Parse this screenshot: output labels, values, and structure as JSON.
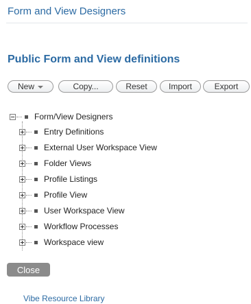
{
  "header": {
    "title": "Form and View Designers"
  },
  "section": {
    "heading": "Public Form and View definitions"
  },
  "toolbar": {
    "new_label": "New",
    "copy_label": "Copy...",
    "reset_label": "Reset",
    "import_label": "Import",
    "export_label": "Export"
  },
  "tree": {
    "root_label": "Form/View Designers",
    "items": [
      {
        "label": "Entry Definitions"
      },
      {
        "label": "External User Workspace View"
      },
      {
        "label": "Folder Views"
      },
      {
        "label": "Profile Listings"
      },
      {
        "label": "Profile View"
      },
      {
        "label": "User Workspace View"
      },
      {
        "label": "Workflow Processes"
      },
      {
        "label": "Workspace view"
      }
    ]
  },
  "actions": {
    "close_label": "Close"
  },
  "footer": {
    "link_label": "Vibe Resource Library"
  },
  "colors": {
    "accent": "#2b6aa3",
    "close_button": "#8b8b8b"
  }
}
